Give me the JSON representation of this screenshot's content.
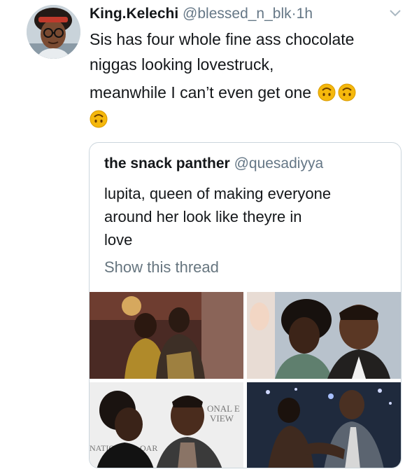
{
  "tweet": {
    "display_name": "King.Kelechi",
    "handle": "@blessed_n_blk",
    "separator": "·",
    "time": "1h",
    "line1": "Sis has four whole fine ass chocolate",
    "line2": "niggas looking lovestruck,",
    "line3": "meanwhile I can’t even get one",
    "emoji_name": "upside-down-face-emoji"
  },
  "quoted_tweet": {
    "display_name": "the snack panther",
    "handle": "@quesadiyya",
    "text_line1": "lupita, queen of making everyone",
    "text_line2": "around her look like theyre in",
    "text_line3": "love",
    "show_thread": "Show this thread",
    "photos": [
      "photo-1",
      "photo-2",
      "photo-3",
      "photo-4"
    ]
  },
  "colors": {
    "text_primary": "#14171a",
    "text_secondary": "#657786",
    "border": "#ccd6dd",
    "emoji_face": "#f5b80c"
  }
}
